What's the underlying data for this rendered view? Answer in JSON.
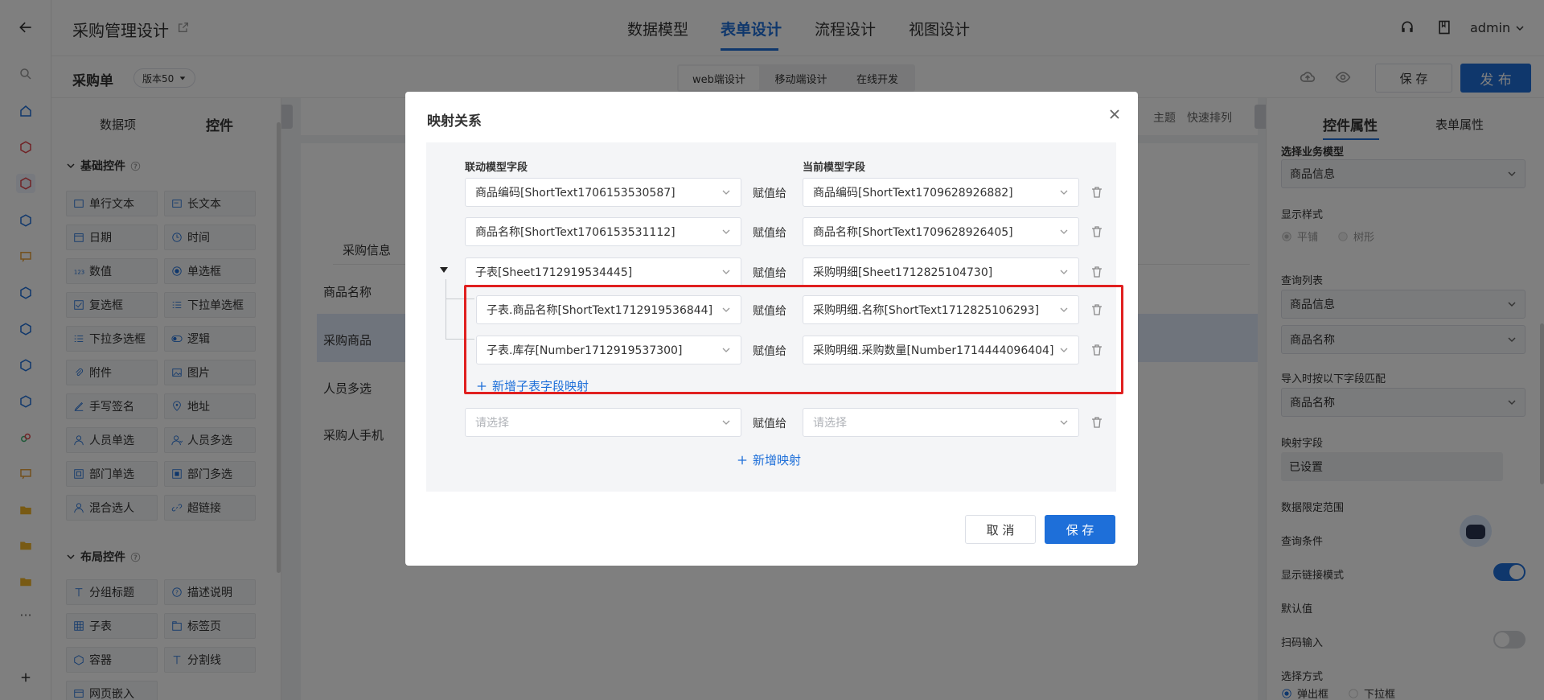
{
  "app": {
    "title": "采购管理设计",
    "user": "admin"
  },
  "nav_tabs": [
    "数据模型",
    "表单设计",
    "流程设计",
    "视图设计"
  ],
  "subbar": {
    "form_name": "采购单",
    "version": "版本50",
    "design_tabs": [
      "web端设计",
      "移动端设计",
      "在线开发"
    ],
    "save": "保 存",
    "publish": "发 布"
  },
  "left": {
    "tabs": [
      "数据项",
      "控件"
    ],
    "basic_title": "基础控件",
    "basic": [
      "单行文本",
      "长文本",
      "日期",
      "时间",
      "数值",
      "单选框",
      "复选框",
      "下拉单选框",
      "下拉多选框",
      "逻辑",
      "附件",
      "图片",
      "手写签名",
      "地址",
      "人员单选",
      "人员多选",
      "部门单选",
      "部门多选",
      "混合选人",
      "超链接"
    ],
    "layout_title": "布局控件",
    "layout": [
      "分组标题",
      "描述说明",
      "子表",
      "标签页",
      "容器",
      "分割线",
      "网页嵌入"
    ]
  },
  "canvas": {
    "toolbar": [
      "主题",
      "快速排列"
    ],
    "group": "采购信息",
    "rows": [
      "商品名称",
      "采购商品",
      "人员多选",
      "采购人手机"
    ]
  },
  "right": {
    "tabs": [
      "控件属性",
      "表单属性"
    ],
    "biz_model_label": "选择业务模型",
    "biz_model": "商品信息",
    "display_style_label": "显示样式",
    "display_options": [
      "平铺",
      "树形"
    ],
    "query_list_label": "查询列表",
    "query_list": "商品信息",
    "query_field": "商品名称",
    "import_label": "导入时按以下字段匹配",
    "import_field": "商品名称",
    "mapping_label": "映射字段",
    "mapping_value": "已设置",
    "data_range_label": "数据限定范围",
    "query_cond_label": "查询条件",
    "link_mode_label": "显示链接模式",
    "default_label": "默认值",
    "scan_label": "扫码输入",
    "select_mode_label": "选择方式",
    "select_options": [
      "弹出框",
      "下拉框"
    ]
  },
  "modal": {
    "title": "映射关系",
    "col_source": "联动模型字段",
    "col_target": "当前模型字段",
    "assign": "赋值给",
    "rows": [
      {
        "source": "商品编码[ShortText1706153530587]",
        "target": "商品编码[ShortText1709628926882]"
      },
      {
        "source": "商品名称[ShortText1706153531112]",
        "target": "商品名称[ShortText1709628926405]"
      },
      {
        "source": "子表[Sheet1712919534445]",
        "target": "采购明细[Sheet1712825104730]"
      }
    ],
    "sub_rows": [
      {
        "source": "子表.商品名称[ShortText1712919536844]",
        "target": "采购明细.名称[ShortText1712825106293]"
      },
      {
        "source": "子表.库存[Number1712919537300]",
        "target": "采购明细.采购数量[Number1714444096404]"
      }
    ],
    "add_sub": "新增子表字段映射",
    "placeholder": "请选择",
    "add_mapping": "新增映射",
    "cancel": "取 消",
    "save": "保 存",
    "highlight_color": "#e02020",
    "accent": "#1e6fd9"
  }
}
